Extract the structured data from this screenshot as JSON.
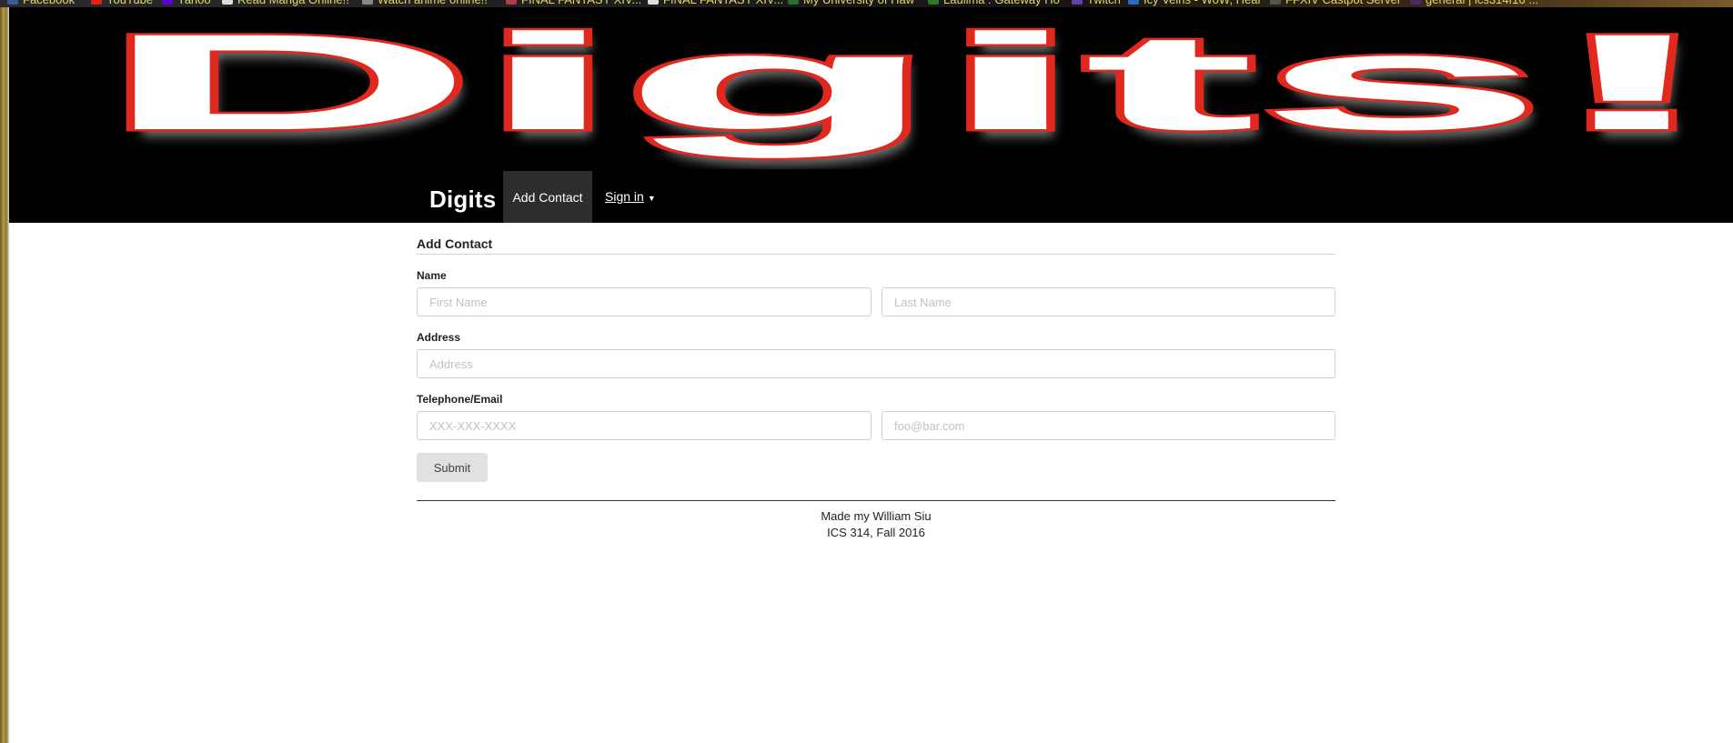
{
  "browser": {
    "bookmarks": [
      {
        "label": "Facebook",
        "color": "#3b5998"
      },
      {
        "label": "YouTube",
        "color": "#e62117"
      },
      {
        "label": "Yahoo",
        "color": "#5f01d1"
      },
      {
        "label": "Read Manga Online!!",
        "color": "#dddddd"
      },
      {
        "label": "Watch anime online!!",
        "color": "#888888"
      },
      {
        "label": "FINAL FANTASY XIV...",
        "color": "#b03a48"
      },
      {
        "label": "FINAL FANTASY XIV...",
        "color": "#dddddd"
      },
      {
        "label": "My University of Haw",
        "color": "#2f6b2f"
      },
      {
        "label": "Laulima : Gateway Ho",
        "color": "#2a7a2a"
      },
      {
        "label": "Twitch",
        "color": "#6441a4"
      },
      {
        "label": "Icy Veins - WoW, Hear",
        "color": "#2a6cc4"
      },
      {
        "label": "FFXIV Castpot Server",
        "color": "#555555"
      },
      {
        "label": "general | ics314f16 ...",
        "color": "#4a2a6a"
      }
    ]
  },
  "banner": {
    "logo_text": "Digits!"
  },
  "navbar": {
    "brand": "Digits",
    "active_item": "Add Contact",
    "signin_label": "Sign in"
  },
  "form": {
    "title": "Add Contact",
    "name_label": "Name",
    "first_name_placeholder": "First Name",
    "last_name_placeholder": "Last Name",
    "address_label": "Address",
    "address_placeholder": "Address",
    "contact_label": "Telephone/Email",
    "phone_placeholder": "XXX-XXX-XXXX",
    "email_placeholder": "foo@bar.com",
    "submit_label": "Submit"
  },
  "footer": {
    "line1": "Made my William Siu",
    "line2": "ICS 314, Fall 2016"
  },
  "colors": {
    "banner_bg": "#000000",
    "logo_fill": "#ffffff",
    "logo_outline": "#e0281e",
    "nav_active_bg": "#2d2d2d",
    "submit_bg": "#e0e1e2"
  }
}
